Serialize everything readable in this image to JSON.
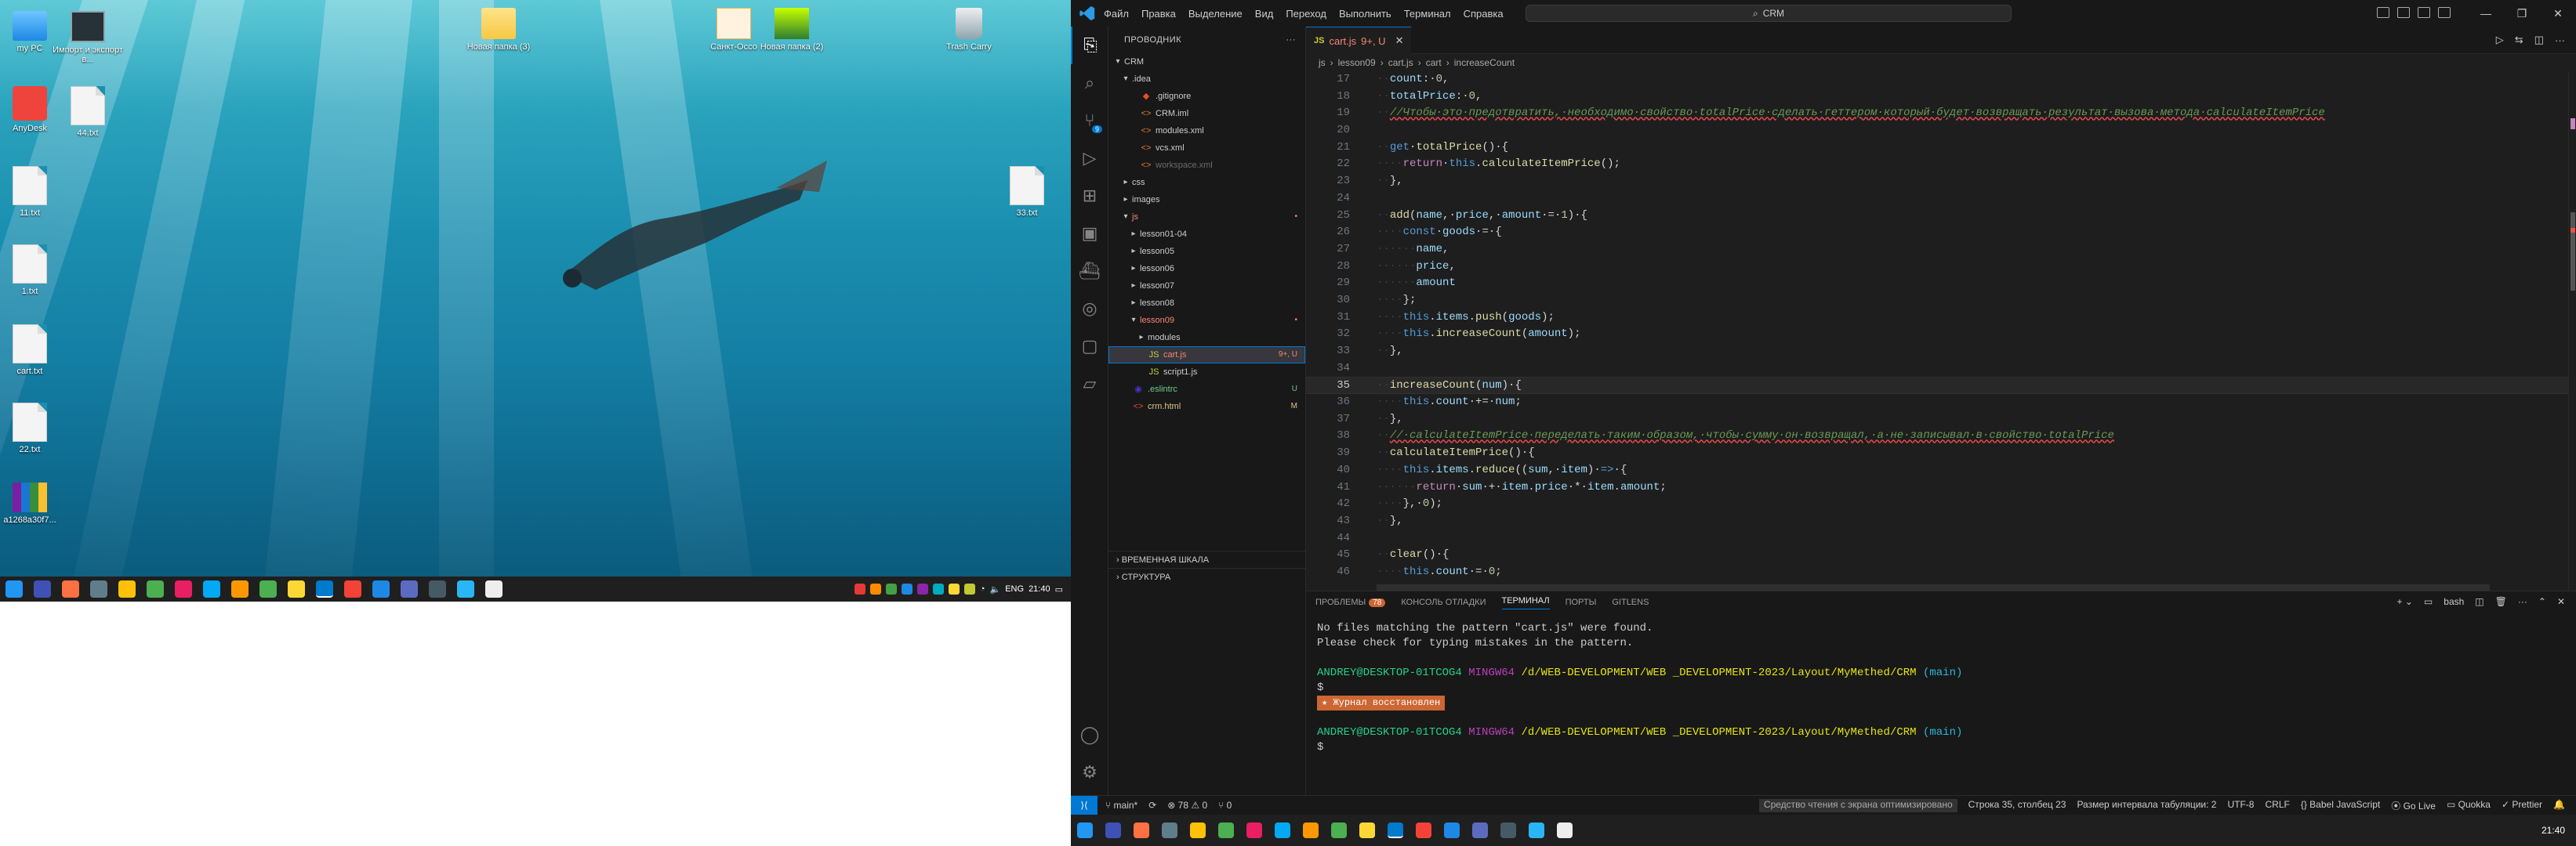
{
  "desktop": {
    "icons": [
      {
        "label": "my PC",
        "kind": "pc"
      },
      {
        "label": "Импорт и экспорт в...",
        "kind": "app"
      },
      {
        "label": "AnyDesk",
        "kind": "anydesk"
      },
      {
        "label": "44.txt",
        "kind": "file"
      },
      {
        "label": "11.txt",
        "kind": "file"
      },
      {
        "label": "1.txt",
        "kind": "file"
      },
      {
        "label": "cart.txt",
        "kind": "file"
      },
      {
        "label": "22.txt",
        "kind": "file"
      },
      {
        "label": "a1268a30f7...",
        "kind": "archive"
      },
      {
        "label": "Новая папка (3)",
        "kind": "folder"
      },
      {
        "label": "Санкт-Оссо",
        "kind": "app"
      },
      {
        "label": "Новая папка (2)",
        "kind": "folder"
      },
      {
        "label": "Trash Carry",
        "kind": "trash"
      },
      {
        "label": "33.txt",
        "kind": "file"
      }
    ],
    "taskbar_clock": "21:40",
    "taskbar_lang": "ENG"
  },
  "vscode": {
    "menu": [
      "Файл",
      "Правка",
      "Выделение",
      "Вид",
      "Переход",
      "Выполнить",
      "Терминал",
      "Справка"
    ],
    "search": "CRM",
    "sidebar_title": "ПРОВОДНИК",
    "root": "CRM",
    "tree": [
      {
        "label": ".idea",
        "depth": 1,
        "kind": "folder",
        "open": true,
        "status": ""
      },
      {
        "label": ".gitignore",
        "depth": 2,
        "kind": "git",
        "status": ""
      },
      {
        "label": "CRM.iml",
        "depth": 2,
        "kind": "xml",
        "status": ""
      },
      {
        "label": "modules.xml",
        "depth": 2,
        "kind": "xml",
        "status": ""
      },
      {
        "label": "vcs.xml",
        "depth": 2,
        "kind": "xml",
        "status": ""
      },
      {
        "label": "workspace.xml",
        "depth": 2,
        "kind": "xml",
        "status": "",
        "dim": true
      },
      {
        "label": "css",
        "depth": 1,
        "kind": "folder",
        "status": ""
      },
      {
        "label": "images",
        "depth": 1,
        "kind": "folder",
        "status": ""
      },
      {
        "label": "js",
        "depth": 1,
        "kind": "folder",
        "open": true,
        "status": "•",
        "err": true
      },
      {
        "label": "lesson01-04",
        "depth": 2,
        "kind": "folder",
        "status": ""
      },
      {
        "label": "lesson05",
        "depth": 2,
        "kind": "folder",
        "status": ""
      },
      {
        "label": "lesson06",
        "depth": 2,
        "kind": "folder",
        "status": ""
      },
      {
        "label": "lesson07",
        "depth": 2,
        "kind": "folder",
        "status": ""
      },
      {
        "label": "lesson08",
        "depth": 2,
        "kind": "folder",
        "status": ""
      },
      {
        "label": "lesson09",
        "depth": 2,
        "kind": "folder",
        "open": true,
        "status": "•",
        "err": true
      },
      {
        "label": "modules",
        "depth": 3,
        "kind": "folder",
        "status": ""
      },
      {
        "label": "cart.js",
        "depth": 3,
        "kind": "js",
        "status": "9+, U",
        "err": true,
        "selected": true
      },
      {
        "label": "script1.js",
        "depth": 3,
        "kind": "js",
        "status": ""
      },
      {
        "label": ".eslintrc",
        "depth": 1,
        "kind": "eslint",
        "status": "U"
      },
      {
        "label": "crm.html",
        "depth": 1,
        "kind": "html",
        "status": "M"
      }
    ],
    "sidebar_footer": [
      "ВРЕМЕННАЯ ШКАЛА",
      "СТРУКТУРА"
    ],
    "tab": {
      "name": "cart.js",
      "status": "9+, U"
    },
    "breadcrumbs": [
      "js",
      "lesson09",
      "cart.js",
      "cart",
      "increaseCount"
    ],
    "code_lines": [
      {
        "n": "17",
        "html": "<span class='dim'>··</span><span class='p'>count</span><span class='o'>:·</span><span class='n'>0</span><span class='o'>,</span>"
      },
      {
        "n": "18",
        "html": "<span class='dim'>··</span><span class='p'>totalPrice</span><span class='o'>:·</span><span class='n'>0</span><span class='o'>,</span>"
      },
      {
        "n": "19",
        "html": "<span class='dim'>··</span><span class='c err'>//Чтобы·это·предотвратить,·необходимо·свойство·totalPrice·сделать·геттером·который·будет·возвращать·результат·вызова·метода·calculateItemPrice</span>"
      },
      {
        "n": "20",
        "html": ""
      },
      {
        "n": "21",
        "html": "<span class='dim'>··</span><span class='t'>get</span><span class='o'>·</span><span class='f'>totalPrice</span><span class='o'>()·{</span>"
      },
      {
        "n": "22",
        "html": "<span class='dim'>····</span><span class='kc'>return</span><span class='o'>·</span><span class='k'>this</span><span class='o'>.</span><span class='f'>calculateItemPrice</span><span class='o'>();</span>"
      },
      {
        "n": "23",
        "html": "<span class='dim'>··</span><span class='o'>},</span>"
      },
      {
        "n": "24",
        "html": ""
      },
      {
        "n": "25",
        "html": "<span class='dim'>··</span><span class='f'>add</span><span class='o'>(</span><span class='p'>name</span><span class='o'>,·</span><span class='p'>price</span><span class='o'>,·</span><span class='p'>amount</span><span class='o'>·=·</span><span class='n'>1</span><span class='o'>)·{</span>"
      },
      {
        "n": "26",
        "html": "<span class='dim'>····</span><span class='t'>const</span><span class='o'>·</span><span class='p'>goods</span><span class='o'>·=·{</span>"
      },
      {
        "n": "27",
        "html": "<span class='dim'>······</span><span class='p'>name</span><span class='o'>,</span>"
      },
      {
        "n": "28",
        "html": "<span class='dim'>······</span><span class='p'>price</span><span class='o'>,</span>"
      },
      {
        "n": "29",
        "html": "<span class='dim'>······</span><span class='p'>amount</span>"
      },
      {
        "n": "30",
        "html": "<span class='dim'>····</span><span class='o'>};</span>"
      },
      {
        "n": "31",
        "html": "<span class='dim'>····</span><span class='k'>this</span><span class='o'>.</span><span class='p'>items</span><span class='o'>.</span><span class='f'>push</span><span class='o'>(</span><span class='p'>goods</span><span class='o'>);</span>"
      },
      {
        "n": "32",
        "html": "<span class='dim'>····</span><span class='k'>this</span><span class='o'>.</span><span class='f'>increaseCount</span><span class='o'>(</span><span class='p'>amount</span><span class='o'>);</span>"
      },
      {
        "n": "33",
        "html": "<span class='dim'>··</span><span class='o'>},</span>"
      },
      {
        "n": "34",
        "html": ""
      },
      {
        "n": "35",
        "html": "<span class='dim'>··</span><span class='f'>increaseCount</span><span class='o'>(</span><span class='p'>num</span><span class='o'>)·{</span>",
        "current": true
      },
      {
        "n": "36",
        "html": "<span class='dim'>····</span><span class='k'>this</span><span class='o'>.</span><span class='p'>count</span><span class='o'>·+=·</span><span class='p'>num</span><span class='o'>;</span>"
      },
      {
        "n": "37",
        "html": "<span class='dim'>··</span><span class='o'>},</span>"
      },
      {
        "n": "38",
        "html": "<span class='dim'>··</span><span class='c err'>//·calculateItemPrice·переделать·таким·образом,·чтобы·сумму·он·возвращал,·а·не·записывал·в·свойство·totalPrice</span>"
      },
      {
        "n": "39",
        "html": "<span class='dim'>··</span><span class='f'>calculateItemPrice</span><span class='o'>()·{</span>"
      },
      {
        "n": "40",
        "html": "<span class='dim'>····</span><span class='k'>this</span><span class='o'>.</span><span class='p'>items</span><span class='o'>.</span><span class='f'>reduce</span><span class='o'>((</span><span class='p'>sum</span><span class='o'>,·</span><span class='p'>item</span><span class='o'>)·</span><span class='t'>=&gt;</span><span class='o'>·{</span>"
      },
      {
        "n": "41",
        "html": "<span class='dim'>······</span><span class='kc'>return</span><span class='o'>·</span><span class='p'>sum</span><span class='o'>·+·</span><span class='p'>item</span><span class='o'>.</span><span class='p'>price</span><span class='o'>·*·</span><span class='p'>item</span><span class='o'>.</span><span class='p'>amount</span><span class='o'>;</span>"
      },
      {
        "n": "42",
        "html": "<span class='dim'>····</span><span class='o'>},·</span><span class='n'>0</span><span class='o'>);</span>"
      },
      {
        "n": "43",
        "html": "<span class='dim'>··</span><span class='o'>},</span>"
      },
      {
        "n": "44",
        "html": ""
      },
      {
        "n": "45",
        "html": "<span class='dim'>··</span><span class='f'>clear</span><span class='o'>()·{</span>"
      },
      {
        "n": "46",
        "html": "<span class='dim'>····</span><span class='k'>this</span><span class='o'>.</span><span class='p'>count</span><span class='o'>·=·</span><span class='n'>0</span><span class='o'>;</span>"
      }
    ],
    "panel_tabs": [
      {
        "label": "ПРОБЛЕМЫ",
        "count": "78"
      },
      {
        "label": "КОНСОЛЬ ОТЛАДКИ",
        "count": ""
      },
      {
        "label": "ТЕРМИНАЛ",
        "count": "",
        "active": true
      },
      {
        "label": "ПОРТЫ",
        "count": ""
      },
      {
        "label": "GITLENS",
        "count": ""
      }
    ],
    "terminal_shell": "bash",
    "terminal": {
      "msg1": "No files matching the pattern \"cart.js\" were found.",
      "msg2": "Please check for typing mistakes in the pattern.",
      "user": "ANDREY@DESKTOP-01TCOG4",
      "sys": "MINGW64",
      "path": "/d/WEB-DEVELOPMENT/WEB _DEVELOPMENT-2023/Layout/MyMethed/CRM",
      "branch": "(main)",
      "prompt": "$",
      "restored": "Журнал восстановлен"
    },
    "status": {
      "branch": "main*",
      "sync": "⟳",
      "problems": "⊗ 78 ⚠ 0",
      "ports": "⑂ 0",
      "tip": "Средство чтения с экрана оптимизировано",
      "position": "Строка 35, столбец 23",
      "indent": "Размер интервала табуляции: 2",
      "encoding": "UTF-8",
      "eol": "CRLF",
      "lang": "{} Babel JavaScript",
      "live": "Go Live",
      "quokka": "Quokka",
      "prettier": "Prettier"
    },
    "taskbar_clock": "21:40"
  }
}
